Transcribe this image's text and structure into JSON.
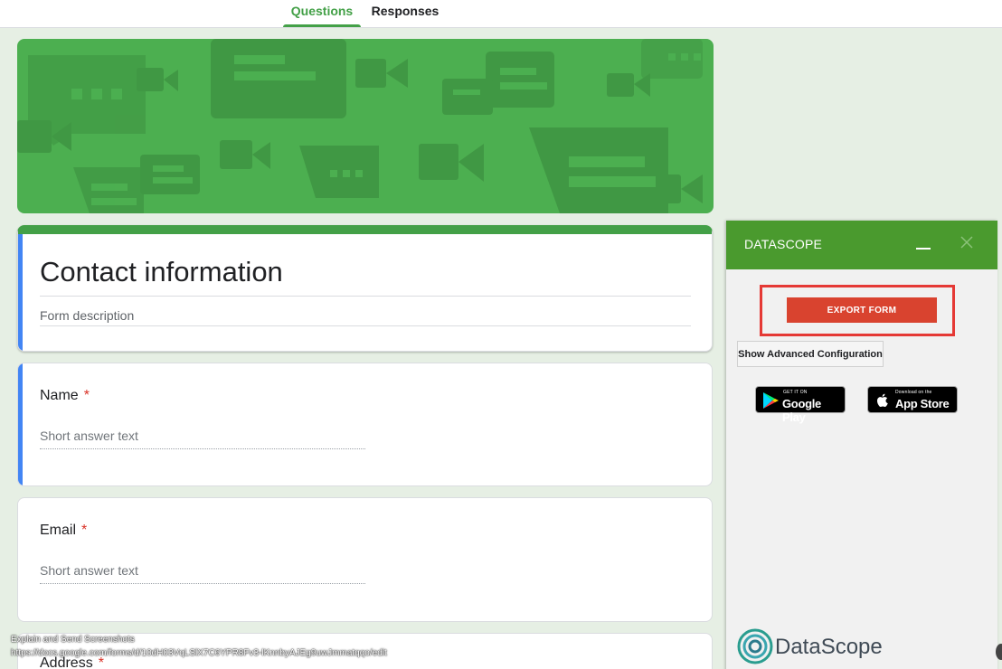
{
  "tabs": [
    {
      "label": "Questions",
      "active": true
    },
    {
      "label": "Responses",
      "active": false
    }
  ],
  "form": {
    "title": "Contact information",
    "description_placeholder": "Form description",
    "questions": [
      {
        "label": "Name",
        "required_mark": "*",
        "hint": "Short answer text"
      },
      {
        "label": "Email",
        "required_mark": "*",
        "hint": "Short answer text"
      },
      {
        "label": "Address",
        "required_mark": "*"
      }
    ]
  },
  "status_overlay": {
    "line1": "Explain and Send Screenshots",
    "line2": "https://docs.google.com/forms/d/10dH03VqLSlX7C6YPR8Fv3-lKnnbyAJEg9uwJmmatqqo/edit"
  },
  "panel": {
    "title": "DATASCOPE",
    "export_label": "EXPORT FORM",
    "advanced_label": "Show Advanced Configuration",
    "google_play": {
      "small": "GET IT ON",
      "big": "Google Play"
    },
    "app_store": {
      "small": "Download on the",
      "big": "App Store"
    },
    "brand_name": "DataScope"
  },
  "colors": {
    "accent": "#43a047",
    "banner": "#4caf50",
    "panel_header": "#4a9a2e",
    "export_button": "#d9432f",
    "highlight_box": "#e53935",
    "required": "#d93025"
  }
}
